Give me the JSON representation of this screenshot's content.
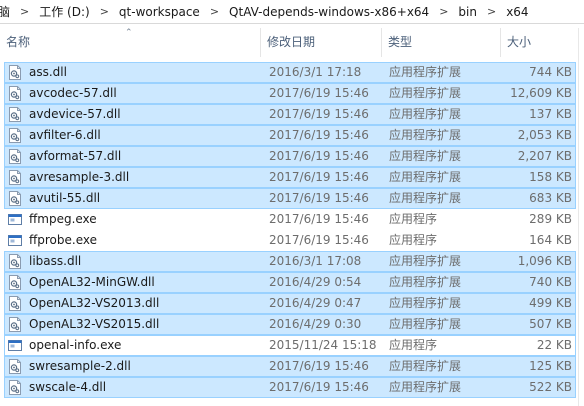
{
  "breadcrumb": [
    "脑",
    "工作 (D:)",
    "qt-workspace",
    "QtAV-depends-windows-x86+x64",
    "bin",
    "x64"
  ],
  "columns": {
    "name": "名称",
    "date": "修改日期",
    "type": "类型",
    "size": "大小"
  },
  "files": [
    {
      "name": "ass.dll",
      "date": "2016/3/1 17:18",
      "type": "应用程序扩展",
      "size": "744 KB",
      "kind": "dll",
      "state": "sel"
    },
    {
      "name": "avcodec-57.dll",
      "date": "2017/6/19 15:46",
      "type": "应用程序扩展",
      "size": "12,609 KB",
      "kind": "dll",
      "state": "sel"
    },
    {
      "name": "avdevice-57.dll",
      "date": "2017/6/19 15:46",
      "type": "应用程序扩展",
      "size": "137 KB",
      "kind": "dll",
      "state": "sel"
    },
    {
      "name": "avfilter-6.dll",
      "date": "2017/6/19 15:46",
      "type": "应用程序扩展",
      "size": "2,053 KB",
      "kind": "dll",
      "state": "sel"
    },
    {
      "name": "avformat-57.dll",
      "date": "2017/6/19 15:46",
      "type": "应用程序扩展",
      "size": "2,207 KB",
      "kind": "dll",
      "state": "sel"
    },
    {
      "name": "avresample-3.dll",
      "date": "2017/6/19 15:46",
      "type": "应用程序扩展",
      "size": "158 KB",
      "kind": "dll",
      "state": "sel"
    },
    {
      "name": "avutil-55.dll",
      "date": "2017/6/19 15:46",
      "type": "应用程序扩展",
      "size": "683 KB",
      "kind": "dll",
      "state": "sel"
    },
    {
      "name": "ffmpeg.exe",
      "date": "2017/6/19 15:46",
      "type": "应用程序",
      "size": "289 KB",
      "kind": "exe",
      "state": "none"
    },
    {
      "name": "ffprobe.exe",
      "date": "2017/6/19 15:46",
      "type": "应用程序",
      "size": "164 KB",
      "kind": "exe",
      "state": "none"
    },
    {
      "name": "libass.dll",
      "date": "2016/3/1 17:08",
      "type": "应用程序扩展",
      "size": "1,096 KB",
      "kind": "dll",
      "state": "sel"
    },
    {
      "name": "OpenAL32-MinGW.dll",
      "date": "2016/4/29 0:54",
      "type": "应用程序扩展",
      "size": "740 KB",
      "kind": "dll",
      "state": "sel"
    },
    {
      "name": "OpenAL32-VS2013.dll",
      "date": "2016/4/29 0:47",
      "type": "应用程序扩展",
      "size": "499 KB",
      "kind": "dll",
      "state": "sel"
    },
    {
      "name": "OpenAL32-VS2015.dll",
      "date": "2016/4/29 0:30",
      "type": "应用程序扩展",
      "size": "507 KB",
      "kind": "dll",
      "state": "sel"
    },
    {
      "name": "openal-info.exe",
      "date": "2015/11/24 15:18",
      "type": "应用程序",
      "size": "22 KB",
      "kind": "exe",
      "state": "focus"
    },
    {
      "name": "swresample-2.dll",
      "date": "2017/6/19 15:46",
      "type": "应用程序扩展",
      "size": "125 KB",
      "kind": "dll",
      "state": "sel"
    },
    {
      "name": "swscale-4.dll",
      "date": "2017/6/19 15:46",
      "type": "应用程序扩展",
      "size": "522 KB",
      "kind": "dll",
      "state": "sel"
    }
  ]
}
